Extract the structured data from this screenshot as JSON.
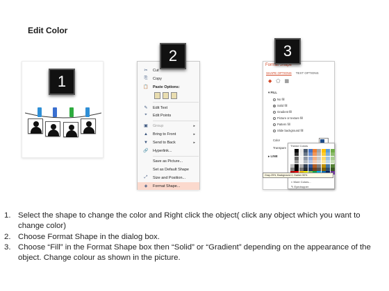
{
  "title": "Edit Color",
  "steps": [
    "1",
    "2",
    "3"
  ],
  "context_menu": {
    "items": [
      {
        "icon": "✂",
        "label": "Cut",
        "dim": false,
        "arrow": false
      },
      {
        "icon": "⎘",
        "label": "Copy",
        "dim": false,
        "arrow": false
      },
      {
        "icon": "📋",
        "label": "Paste Options:",
        "dim": false,
        "arrow": false
      },
      {
        "icon": "✎",
        "label": "Edit Text",
        "dim": false,
        "arrow": false
      },
      {
        "icon": "⌖",
        "label": "Edit Points",
        "dim": false,
        "arrow": false
      },
      {
        "icon": "▣",
        "label": "Group",
        "dim": true,
        "arrow": true
      },
      {
        "icon": "▲",
        "label": "Bring to Front",
        "dim": false,
        "arrow": true
      },
      {
        "icon": "▼",
        "label": "Send to Back",
        "dim": false,
        "arrow": true
      },
      {
        "icon": "🔗",
        "label": "Hyperlink...",
        "dim": false,
        "arrow": false
      },
      {
        "icon": "",
        "label": "Save as Picture...",
        "dim": false,
        "arrow": false
      },
      {
        "icon": "",
        "label": "Set as Default Shape",
        "dim": false,
        "arrow": false
      },
      {
        "icon": "⤢",
        "label": "Size and Position...",
        "dim": false,
        "arrow": false
      },
      {
        "icon": "◈",
        "label": "Format Shape...",
        "dim": false,
        "arrow": false,
        "highlight": true
      }
    ]
  },
  "format_pane": {
    "header": "Format Shape",
    "tabs": [
      "SHAPE OPTIONS",
      "TEXT OPTIONS"
    ],
    "fill_section": "FILL",
    "fill_options": [
      {
        "label": "No fill",
        "selected": false
      },
      {
        "label": "Solid fill",
        "selected": true
      },
      {
        "label": "Gradient fill",
        "selected": false
      },
      {
        "label": "Picture or texture fill",
        "selected": false
      },
      {
        "label": "Pattern fill",
        "selected": false
      },
      {
        "label": "Slide background fill",
        "selected": false
      }
    ],
    "color_label": "Color",
    "transparency_label": "Transpare",
    "line_section": "LINE",
    "theme_colors_label": "Theme Colors",
    "tooltip": "Gray-25%, Background 2, Darker 90%",
    "more_colors": "More Colors...",
    "eyedropper": "Eyedropper"
  },
  "instructions": [
    {
      "num": "1.",
      "text": "Select the shape to change the color and Right click the object( click any object which you want to change color)"
    },
    {
      "num": "2.",
      "text": "Choose Format Shape in the dialog box."
    },
    {
      "num": "3.",
      "text": "Choose “Fill” in the Format Shape box then “Solid” or “Gradient” depending on the appearance of the object. Change colour as shown in the picture."
    }
  ],
  "colors": {
    "accent": "#d24726",
    "badge_bg": "#111111",
    "menu_highlight": "#fbd9cd"
  }
}
